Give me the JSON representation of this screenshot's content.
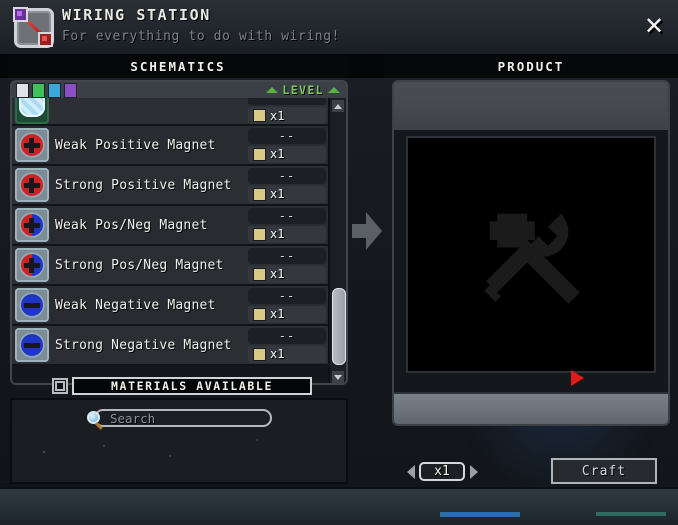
{
  "window": {
    "title": "WIRING STATION",
    "subtitle": "For everything to do with wiring!",
    "icon": "wiring-tool-icon",
    "close_label": "✕"
  },
  "tabs": {
    "schematics": "SCHEMATICS",
    "product": "PRODUCT"
  },
  "filter_bar": {
    "rarity_swatches": [
      {
        "name": "common",
        "color": "#dfe2e6"
      },
      {
        "name": "uncommon",
        "color": "#3dc15a"
      },
      {
        "name": "rare",
        "color": "#3aa8d8"
      },
      {
        "name": "legendary",
        "color": "#8a4fc4"
      }
    ],
    "sort_label": "LEVEL",
    "sort_color": "#7ac95a",
    "sort_arrow_left": "triangle-up-icon",
    "sort_arrow_right": "triangle-up-icon"
  },
  "schematics": {
    "rows": [
      {
        "name": "",
        "icon": "ice-block-icon",
        "icon_type": "ice",
        "dashes": "",
        "count": "x1",
        "partial": true
      },
      {
        "name": "Weak Positive Magnet",
        "icon": "magnet-positive-icon",
        "icon_type": "magnet",
        "orb_color": "#cc2222",
        "symbol": "plus",
        "dashes": "--",
        "count": "x1"
      },
      {
        "name": "Strong Positive Magnet",
        "icon": "magnet-positive-icon",
        "icon_type": "magnet",
        "orb_color": "#cc2222",
        "symbol": "plus",
        "dashes": "--",
        "count": "x1"
      },
      {
        "name": "Weak Pos/Neg Magnet",
        "icon": "magnet-posneg-icon",
        "icon_type": "magnet",
        "orb_color": "split",
        "symbol": "plus",
        "dashes": "--",
        "count": "x1"
      },
      {
        "name": "Strong Pos/Neg Magnet",
        "icon": "magnet-posneg-icon",
        "icon_type": "magnet",
        "orb_color": "split",
        "symbol": "plus",
        "dashes": "--",
        "count": "x1"
      },
      {
        "name": "Weak Negative Magnet",
        "icon": "magnet-negative-icon",
        "icon_type": "magnet",
        "orb_color": "#1e35c8",
        "symbol": "minus",
        "dashes": "--",
        "count": "x1"
      },
      {
        "name": "Strong Negative Magnet",
        "icon": "magnet-negative-icon",
        "icon_type": "magnet",
        "orb_color": "#1e35c8",
        "symbol": "minus",
        "dashes": "--",
        "count": "x1"
      }
    ],
    "scrollbar": {
      "up_arrow": "triangle-up-icon",
      "down_arrow": "triangle-down-icon"
    }
  },
  "materials": {
    "checkbox_state": "unchecked",
    "label": "MATERIALS AVAILABLE"
  },
  "search": {
    "placeholder": "Search",
    "value": "",
    "icon": "magnifier-icon"
  },
  "product": {
    "watermark": "hammer-and-wrench-icon",
    "selected_item": ""
  },
  "footer": {
    "qty_value": "x1",
    "qty_decrease": "triangle-left-icon",
    "qty_increase": "triangle-right-icon",
    "craft_label": "Craft"
  },
  "cursor": {
    "icon": "cursor-arrow-icon",
    "color": "#e01b1b"
  }
}
